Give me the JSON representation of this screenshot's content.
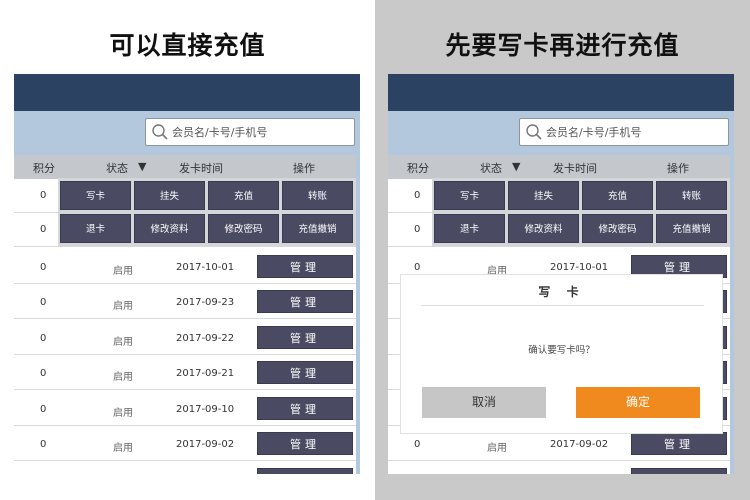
{
  "left_panel": {
    "heading": "可以直接充值",
    "search_placeholder": "会员名/卡号/手机号",
    "columns": {
      "points": "积分",
      "status": "状态",
      "date": "发卡时间",
      "action": "操作"
    },
    "menu_rows": [
      {
        "points": "0"
      },
      {
        "points": "0"
      }
    ],
    "ops_buttons": [
      "写卡",
      "挂失",
      "充值",
      "转账",
      "退卡",
      "修改资料",
      "修改密码",
      "充值撤销"
    ],
    "rows": [
      {
        "points": "0",
        "status": "启用",
        "date": "2017-10-01",
        "action": "管理"
      },
      {
        "points": "0",
        "status": "启用",
        "date": "2017-09-23",
        "action": "管理"
      },
      {
        "points": "0",
        "status": "启用",
        "date": "2017-09-22",
        "action": "管理"
      },
      {
        "points": "0",
        "status": "启用",
        "date": "2017-09-21",
        "action": "管理"
      },
      {
        "points": "0",
        "status": "启用",
        "date": "2017-09-10",
        "action": "管理"
      },
      {
        "points": "0",
        "status": "启用",
        "date": "2017-09-02",
        "action": "管理"
      }
    ]
  },
  "right_panel": {
    "heading": "先要写卡再进行充值",
    "search_placeholder": "会员名/卡号/手机号",
    "columns": {
      "points": "积分",
      "status": "状态",
      "date": "发卡时间",
      "action": "操作"
    },
    "menu_rows": [
      {
        "points": "0"
      },
      {
        "points": "0"
      }
    ],
    "ops_buttons": [
      "写卡",
      "挂失",
      "充值",
      "转账",
      "退卡",
      "修改资料",
      "修改密码",
      "充值撤销"
    ],
    "rows": [
      {
        "points": "0",
        "status": "启用",
        "date": "2017-10-01",
        "action": "管理"
      },
      {
        "points": "",
        "status": "",
        "date": "",
        "action": ""
      },
      {
        "points": "",
        "status": "",
        "date": "",
        "action": ""
      },
      {
        "points": "",
        "status": "",
        "date": "",
        "action": ""
      },
      {
        "points": "",
        "status": "",
        "date": "",
        "action": ""
      },
      {
        "points": "0",
        "status": "启用",
        "date": "2017-09-02",
        "action": "管理"
      }
    ],
    "dialog": {
      "title": "写 卡",
      "message": "确认要写卡吗？",
      "cancel": "取消",
      "confirm": "确定"
    }
  },
  "colors": {
    "header_bar": "#2c4262",
    "search_band": "#b3c8dd",
    "button_dark": "#4a4a62",
    "confirm_orange": "#f08a1e",
    "cancel_gray": "#c6c6c6",
    "right_background": "#c9c9c9"
  },
  "icons": {
    "search": "search-icon",
    "sort": "triangle-down-icon"
  }
}
